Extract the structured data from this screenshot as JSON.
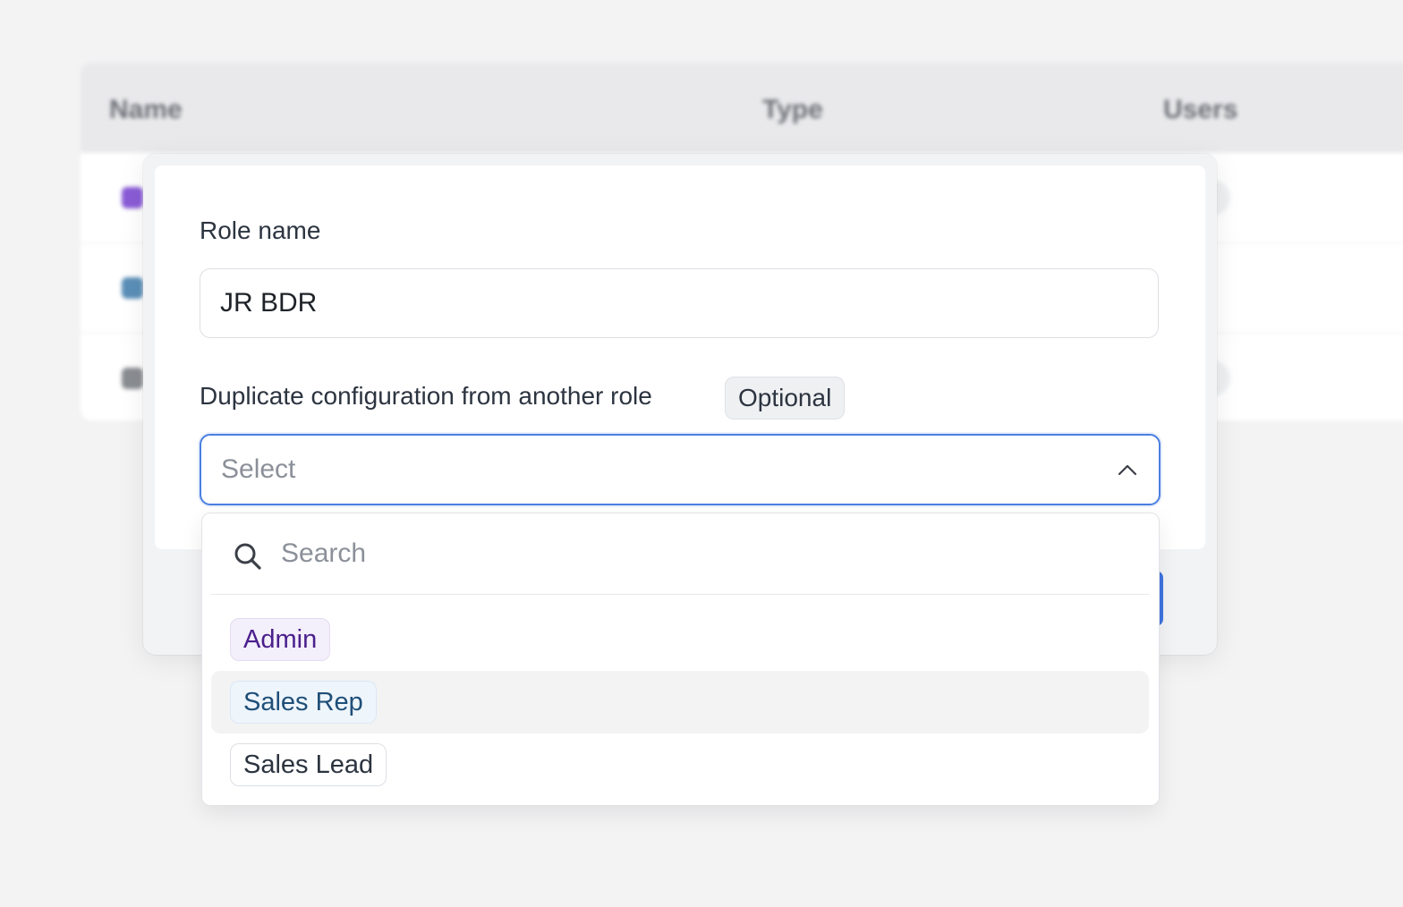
{
  "background_table": {
    "columns": [
      "Name",
      "Type",
      "Users"
    ],
    "rows": [
      {
        "icon": "user-admin-icon",
        "icon_color": "#8a5cd6"
      },
      {
        "icon": "user-rep-icon",
        "icon_color": "#5b8fb8"
      },
      {
        "icon": "users-icon",
        "icon_color": "#8a8d92"
      }
    ]
  },
  "form": {
    "role_name_label": "Role name",
    "role_name_value": "JR BDR",
    "duplicate_label": "Duplicate configuration from another role",
    "optional_badge": "Optional",
    "select_placeholder": "Select"
  },
  "dropdown": {
    "search_placeholder": "Search",
    "options": [
      {
        "label": "Admin",
        "style": "admin"
      },
      {
        "label": "Sales Rep",
        "style": "salesrep",
        "hovered": true
      },
      {
        "label": "Sales Lead",
        "style": "saleslead"
      }
    ]
  },
  "colors": {
    "accent": "#4a7fe0",
    "primary_button": "#3f74e0"
  }
}
